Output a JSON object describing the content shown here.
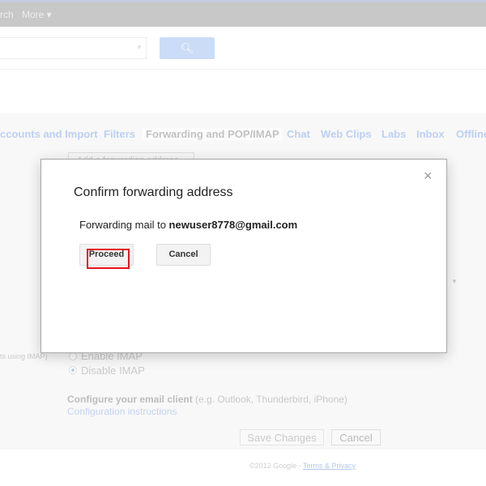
{
  "topbar": {
    "links": [
      "rch",
      "More ▾"
    ]
  },
  "search": {
    "button_icon": "search-icon"
  },
  "tabs": [
    "ccounts and Import",
    "Filters",
    "Forwarding and POP/IMAP",
    "Chat",
    "Web Clips",
    "Labs",
    "Inbox",
    "Offline"
  ],
  "settings": {
    "add_forwarding": "Add a forwarding address",
    "imap_label": "ts using IMAP)",
    "enable_imap": "Enable IMAP",
    "disable_imap": "Disable IMAP",
    "configure_bold": "Configure your email client",
    "configure_rest": " (e.g. Outlook, Thunderbird, iPhone)",
    "config_link": "Configuration instructions",
    "save": "Save Changes",
    "cancel": "Cancel"
  },
  "footer": {
    "copyright": "©2012 Google - ",
    "terms": "Terms & Privacy"
  },
  "dialog": {
    "title": "Confirm forwarding address",
    "message": "Forwarding mail to ",
    "email": "newuser8778@gmail.com",
    "proceed": "Proceed",
    "cancel": "Cancel",
    "close": "×",
    "highlight_color": "#e5141e"
  }
}
